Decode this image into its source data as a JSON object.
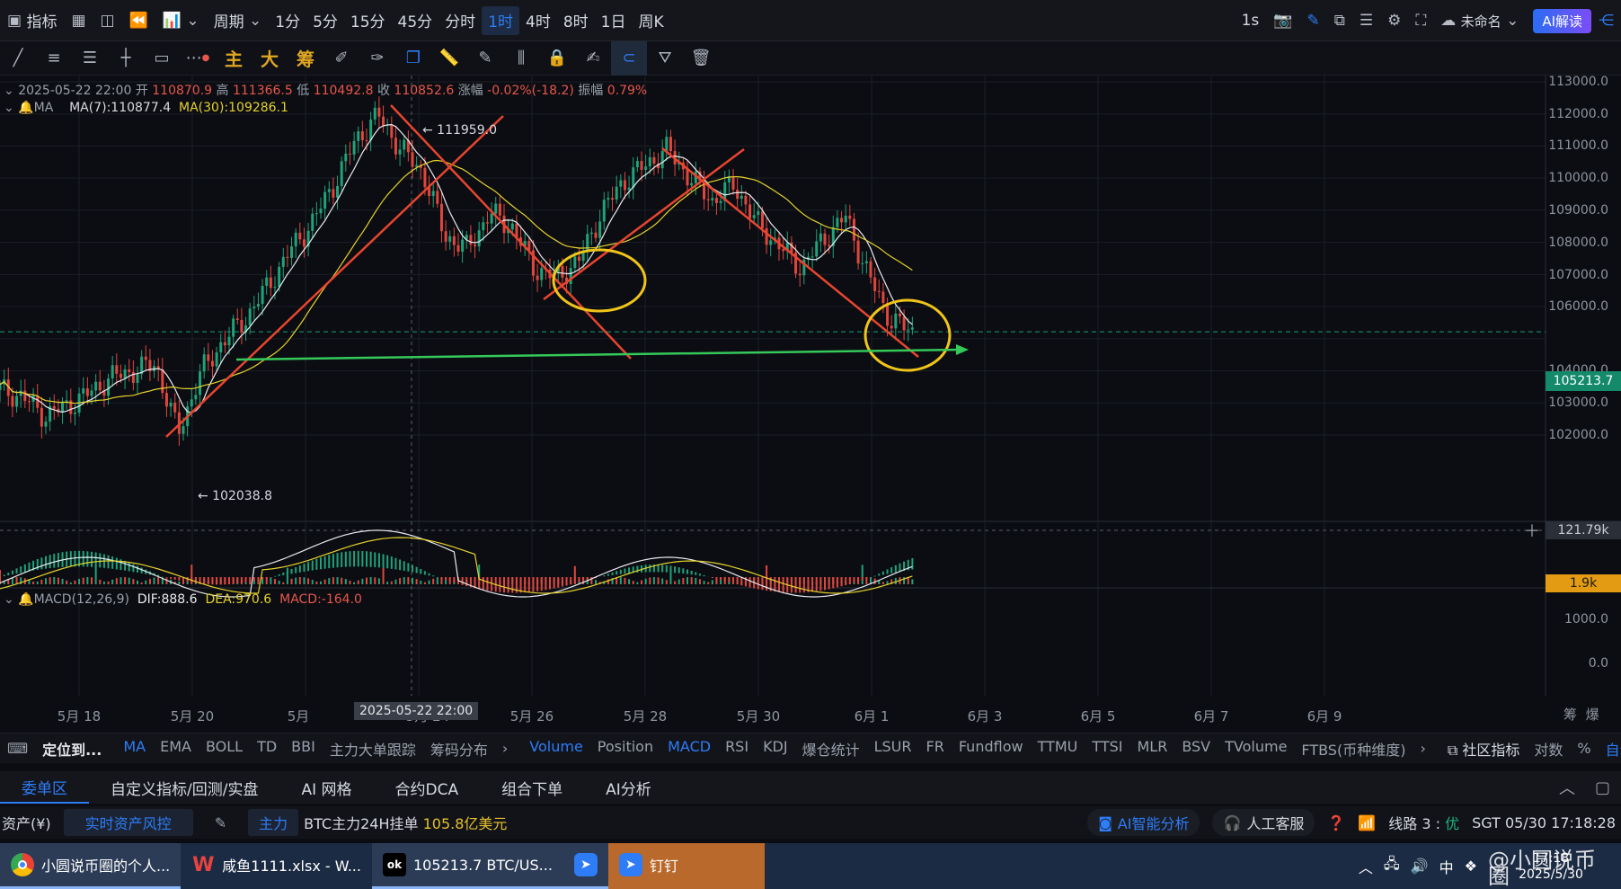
{
  "topbar": {
    "indicators_label": "指标",
    "period_label": "周期",
    "periods": [
      "1分",
      "5分",
      "15分",
      "45分",
      "分时",
      "1时",
      "4时",
      "8时",
      "1日",
      "周K"
    ],
    "active_period": "1时",
    "right_interval": "1s",
    "workspace_name": "未命名",
    "ai_button": "AI解读"
  },
  "drawbar": {
    "labels": [
      "主",
      "大",
      "筹"
    ]
  },
  "ohlc": {
    "datetime": "2025-05-22 22:00",
    "open_label": "开",
    "open": "110870.9",
    "high_label": "高",
    "high": "111366.5",
    "low_label": "低",
    "low": "110492.8",
    "close_label": "收",
    "close": "110852.6",
    "change_label": "涨幅",
    "change": "-0.02%(-18.2)",
    "amp_label": "振幅",
    "amp": "0.79%"
  },
  "ma": {
    "title": "MA",
    "ma7": "MA(7):110877.4",
    "ma30": "MA(30):109286.1"
  },
  "annotations": {
    "high_marker": "← 111959.0",
    "low_marker": "← 102038.8"
  },
  "price_axis": {
    "ticks": [
      "113000.0",
      "112000.0",
      "111000.0",
      "110000.0",
      "109000.0",
      "108000.0",
      "107000.0",
      "106000.0",
      "104000.0",
      "103000.0",
      "102000.0"
    ],
    "current_price": "105213.7",
    "volume_max": "121.79k",
    "volume_current": "1.9k",
    "macd_ticks": [
      "1000.0",
      "0.0"
    ]
  },
  "macd": {
    "title": "MACD(12,26,9)",
    "dif": "DIF:888.6",
    "dea": "DEA:970.6",
    "macd": "MACD:-164.0"
  },
  "dates": [
    "5月 18",
    "5月 20",
    "5月",
    "5月 24",
    "5月 26",
    "5月 28",
    "5月 30",
    "6月 1",
    "6月 3",
    "6月 5",
    "6月 7",
    "6月 9"
  ],
  "cursor_date": "2025-05-22 22:00",
  "axis_corner": [
    "筹",
    "爆"
  ],
  "indicator_bar": {
    "locate": "定位到...",
    "main": [
      "MA",
      "EMA",
      "BOLL",
      "TD",
      "BBI",
      "主力大单跟踪",
      "筹码分布"
    ],
    "sub": [
      "Volume",
      "Position",
      "MACD",
      "RSI",
      "KDJ",
      "爆仓统计",
      "LSUR",
      "FR",
      "Fundflow",
      "TTMU",
      "TTSI",
      "MLR",
      "BSV",
      "TVolume",
      "FTBS(币种维度)"
    ],
    "community": "社区指标",
    "log": "对数",
    "percent": "%",
    "auto": "自动"
  },
  "panel_tabs": [
    "委单区",
    "自定义指标/回测/实盘",
    "AI 网格",
    "合约DCA",
    "组合下单",
    "AI分析"
  ],
  "status": {
    "asset": "资产(¥)",
    "risk": "实时资产风控",
    "main_tag": "主力",
    "btc_text": "BTC主力24H挂单",
    "btc_value": "105.8亿美元",
    "ai_analysis": "AI智能分析",
    "service": "人工客服",
    "line": "线路 3 :",
    "line_quality": "优",
    "clock": "SGT  05/30 17:18:28"
  },
  "taskbar": {
    "tasks": [
      "小圆说币圈的个人...",
      "咸鱼1111.xlsx - W...",
      "105213.7 BTC/US...",
      "",
      "钉钉"
    ],
    "lang": "中",
    "watermark": "@小圆说币圈",
    "time": "17:18",
    "date": "2025/5/30"
  },
  "chart_data": {
    "type": "candlestick",
    "title": "",
    "interval": "1时",
    "x": [
      "5月 18",
      "5月 20",
      "5月 22",
      "5月 24",
      "5月 26",
      "5月 28",
      "5月 30"
    ],
    "ylim": [
      101500,
      113200
    ],
    "key_points": {
      "high": 111959.0,
      "low": 102038.8,
      "last": 105213.7
    },
    "path_close": [
      103400,
      103200,
      102600,
      102900,
      103300,
      103800,
      104000,
      104200,
      102038.8,
      103900,
      104900,
      105600,
      106600,
      107700,
      108600,
      109800,
      111200,
      111959.0,
      110900,
      110200,
      108200,
      107800,
      108900,
      108500,
      107200,
      106900,
      107400,
      108900,
      109900,
      110400,
      110900,
      110000,
      109300,
      109800,
      108600,
      107900,
      107200,
      108100,
      108800,
      107000,
      105600,
      105213.7
    ],
    "series": [
      {
        "name": "MA(7)",
        "last": 110877.4
      },
      {
        "name": "MA(30)",
        "last": 109286.1
      }
    ],
    "volume": {
      "max": "121.79k",
      "current": "1.9k"
    },
    "macd": {
      "dif": 888.6,
      "dea": 970.6,
      "macd": -164.0
    }
  }
}
